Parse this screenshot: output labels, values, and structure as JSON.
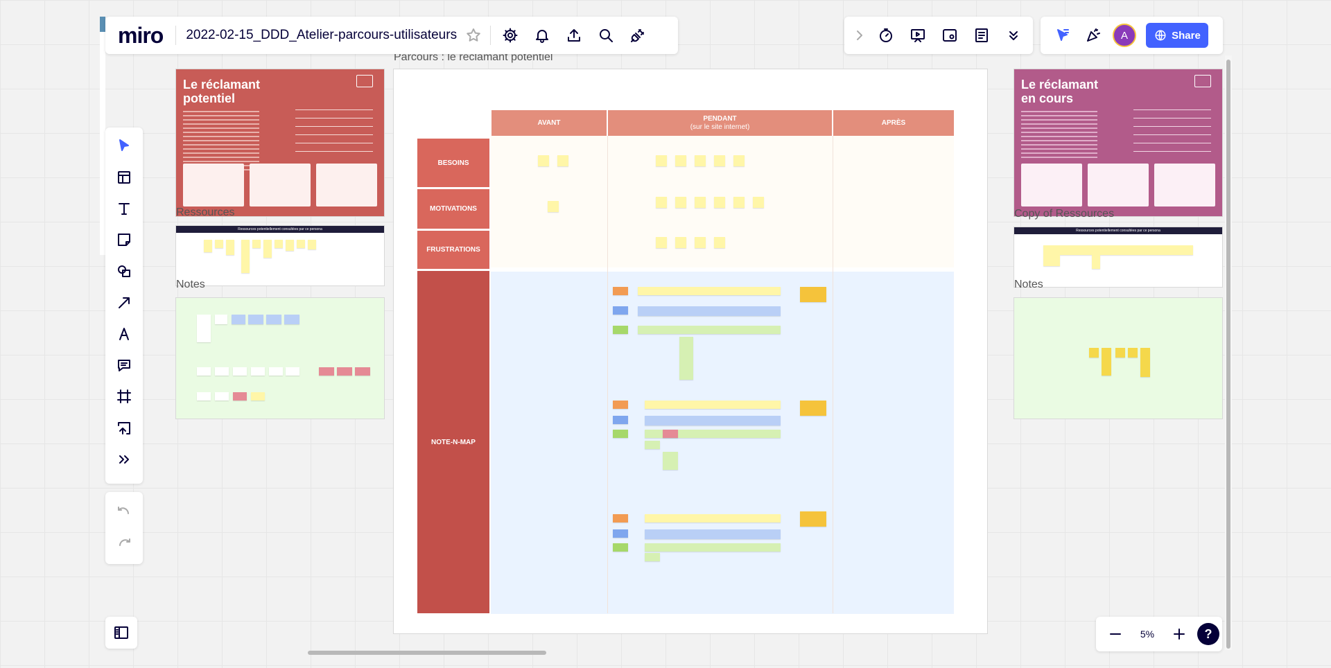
{
  "app": {
    "logo": "miro",
    "board_title": "2022-02-15_DDD_Atelier-parcours-utilisateurs",
    "share_label": "Share",
    "avatar_initial": "A",
    "zoom_level": "5%",
    "help_label": "?"
  },
  "colors": {
    "accent": "#4262ff",
    "avatar": "#8a3ab9",
    "persona_red": "#c85c57",
    "persona_pink": "#b25b8a",
    "journey_header": "#e38e7c",
    "journey_row": "#d9675c",
    "journey_row_dark": "#c2504a",
    "notes_bg": "#eafbe3"
  },
  "board": {
    "left_column": {
      "persona_title": "Le réclamant potentiel",
      "resources_label": "Ressources",
      "resources_banner": "Ressources potentiellement consultées par ce persona",
      "notes_label": "Notes"
    },
    "right_column": {
      "persona_title": "Le réclamant en cours",
      "resources_label": "Copy of Ressources",
      "resources_banner": "Ressources potentiellement consultées par ce persona",
      "notes_label": "Notes"
    },
    "journey": {
      "frame_label": "Parcours : le réclamant potentiel",
      "columns": [
        "AVANT",
        "PENDANT",
        "(sur le site internet)",
        "APRÈS"
      ],
      "rows": [
        "BESOINS",
        "MOTIVATIONS",
        "FRUSTRATIONS",
        "NOTE-N-MAP"
      ]
    }
  }
}
